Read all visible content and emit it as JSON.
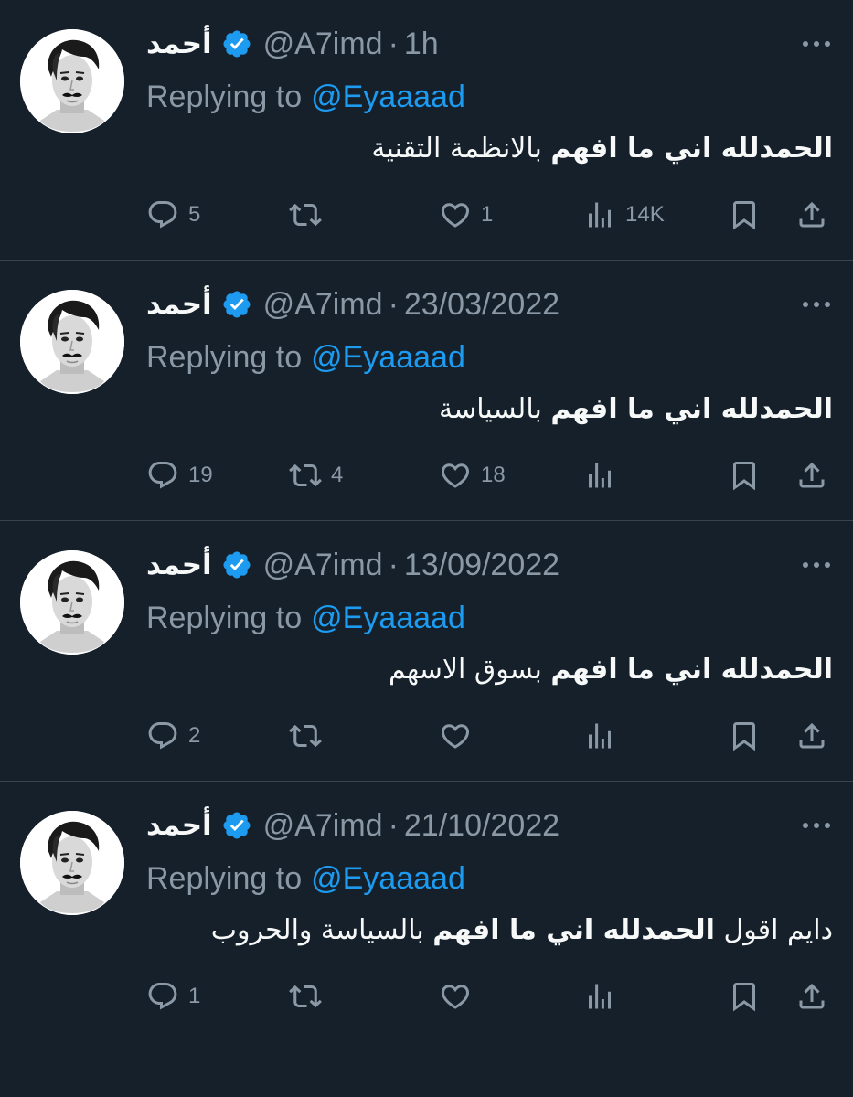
{
  "colors": {
    "background": "#15202b",
    "text": "#f7f9f9",
    "secondary": "#8b98a5",
    "accent": "#1d9bf0",
    "divider": "#38444d"
  },
  "tweets": [
    {
      "name": "أحمد",
      "handle": "@A7imd",
      "separator": "·",
      "time": "1h",
      "replying_prefix": "Replying to",
      "replying_handle": "@Eyaaaad",
      "text_bold": "الحمدلله اني ما افهم",
      "text_regular": " بالانظمة التقنية",
      "counts": {
        "replies": "5",
        "retweets": "",
        "likes": "1",
        "views": "14K"
      }
    },
    {
      "name": "أحمد",
      "handle": "@A7imd",
      "separator": "·",
      "time": "23/03/2022",
      "replying_prefix": "Replying to",
      "replying_handle": "@Eyaaaad",
      "text_bold": "الحمدلله اني ما افهم",
      "text_regular": " بالسياسة",
      "counts": {
        "replies": "19",
        "retweets": "4",
        "likes": "18",
        "views": ""
      }
    },
    {
      "name": "أحمد",
      "handle": "@A7imd",
      "separator": "·",
      "time": "13/09/2022",
      "replying_prefix": "Replying to",
      "replying_handle": "@Eyaaaad",
      "text_bold": "الحمدلله اني ما افهم",
      "text_regular": " بسوق الاسهم",
      "counts": {
        "replies": "2",
        "retweets": "",
        "likes": "",
        "views": ""
      }
    },
    {
      "name": "أحمد",
      "handle": "@A7imd",
      "separator": "·",
      "time": "21/10/2022",
      "replying_prefix": "Replying to",
      "replying_handle": "@Eyaaaad",
      "text_prefix": "دايم اقول ",
      "text_bold": "الحمدلله اني ما افهم",
      "text_regular": " بالسياسة والحروب",
      "counts": {
        "replies": "1",
        "retweets": "",
        "likes": "",
        "views": ""
      }
    }
  ],
  "icons": {
    "avatar": "avatar-portrait",
    "verified": "verified-badge-icon",
    "more": "more-dots-icon",
    "reply": "reply-bubble-icon",
    "retweet": "retweet-icon",
    "like": "heart-icon",
    "views": "views-bar-chart-icon",
    "bookmark": "bookmark-icon",
    "share": "share-upload-icon"
  }
}
